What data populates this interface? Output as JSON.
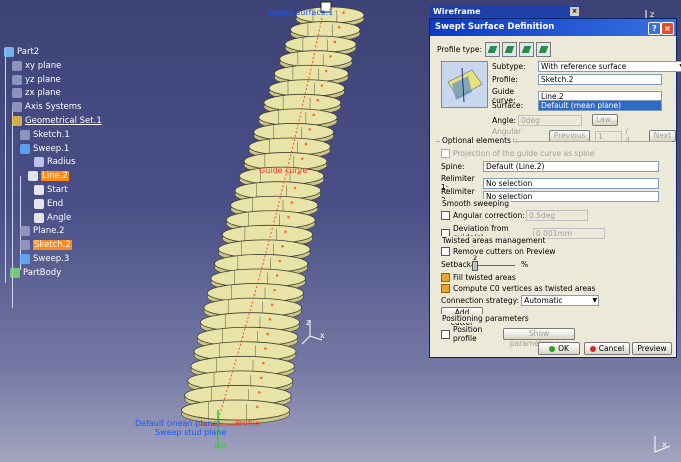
{
  "viewport": {
    "labels": {
      "sweep_top": "Sweep.surface.1",
      "guide_curve": "Guide curve",
      "bottom1": "Default (mean plane)",
      "bottom2": "Sweep stud plane",
      "bottom3": "Profile",
      "hm": "HM"
    },
    "axis": {
      "z": "z",
      "x": "x",
      "y": "y"
    }
  },
  "tree": {
    "items": [
      {
        "label": "Part2",
        "selected": false,
        "underline": false
      },
      {
        "label": "xy plane",
        "selected": false,
        "underline": false
      },
      {
        "label": "yz plane",
        "selected": false,
        "underline": false
      },
      {
        "label": "zx plane",
        "selected": false,
        "underline": false
      },
      {
        "label": "Axis Systems",
        "selected": false,
        "underline": false
      },
      {
        "label": "Geometrical Set.1",
        "selected": false,
        "underline": true
      },
      {
        "label": "Sketch.1",
        "selected": false,
        "underline": false
      },
      {
        "label": "Sweep.1",
        "selected": false,
        "underline": false
      },
      {
        "label": "Radius",
        "selected": false,
        "underline": false
      },
      {
        "label": "Line.2",
        "selected": true,
        "underline": false
      },
      {
        "label": "Start",
        "selected": false,
        "underline": false
      },
      {
        "label": "End",
        "selected": false,
        "underline": false
      },
      {
        "label": "Angle",
        "selected": false,
        "underline": false
      },
      {
        "label": "Plane.2",
        "selected": false,
        "underline": false
      },
      {
        "label": "Sketch.2",
        "selected": true,
        "underline": false
      },
      {
        "label": "Sweep.3",
        "selected": false,
        "underline": false
      },
      {
        "label": "PartBody",
        "selected": false,
        "underline": false
      }
    ]
  },
  "wireframe": {
    "title": "Wireframe",
    "close": "×"
  },
  "dialog": {
    "title": "Swept Surface Definition",
    "help": "?",
    "close": "×",
    "profile_type_label": "Profile type:",
    "subtype_label": "Subtype:",
    "subtype_value": "With reference surface",
    "profile_label": "Profile:",
    "profile_value": "Sketch.2",
    "guide_label": "Guide curve:",
    "guide_value": "Line.2",
    "surface_label": "Surface:",
    "surface_value": "Default (mean plane)",
    "angle_label": "Angle:",
    "angle_value": "0deg",
    "law_btn": "Law...",
    "angular_sector_label": "Angular sector:",
    "previous_btn": "Previous",
    "sector_value": "1",
    "sector_total": "/ 4",
    "next_btn": "Next",
    "optional_elements": "Optional elements",
    "projection_label": "Projection of the guide curve as spine",
    "spine_label": "Spine:",
    "spine_value": "Default (Line.2)",
    "relim1_label": "Relimiter 1:",
    "relim1_value": "No selection",
    "relim2_label": "Relimiter 2:",
    "relim2_value": "No selection",
    "smooth_sweeping": "Smooth sweeping",
    "angular_correction_label": "Angular correction:",
    "angular_correction_value": "0.5deg",
    "deviation_label": "Deviation from guide(s):",
    "deviation_value": "0.001mm",
    "twisted_areas": "Twisted areas management",
    "remove_cutters": "Remove cutters on Preview",
    "setback_label": "Setback",
    "setback_value": "2",
    "setback_unit": "%",
    "fill_twisted": "Fill twisted areas",
    "compute_c0": "Compute C0 vertices as twisted areas",
    "connection_label": "Connection strategy:",
    "connection_value": "Automatic",
    "add_cutter": "Add cutter",
    "positioning": "Positioning parameters",
    "position_profile": "Position profile",
    "show_params": "Show parameters >>",
    "ok": "OK",
    "cancel": "Cancel",
    "preview": "Preview"
  },
  "colors": {
    "accent": "#0a3bc4",
    "selection": "#ff8a1c",
    "surface": "#e8e3a6"
  }
}
